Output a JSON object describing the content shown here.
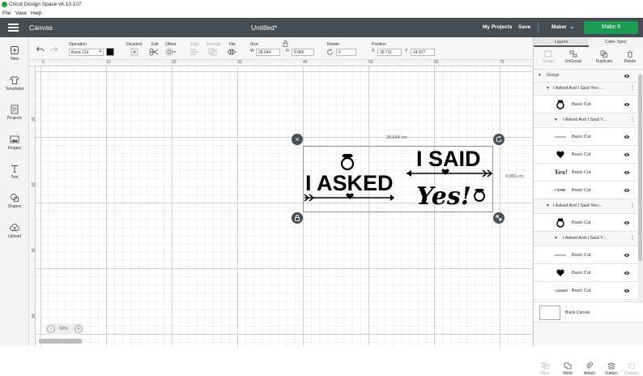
{
  "app": {
    "title": "Cricut Design Space  v6.10.107",
    "menu": [
      "File",
      "View",
      "Help"
    ]
  },
  "header": {
    "canvas_label": "Canvas",
    "doc_title": "Untitled*",
    "my_projects": "My Projects",
    "save": "Save",
    "machine": "Maker",
    "make_it": "Make It"
  },
  "sidebar": {
    "items": [
      {
        "label": "New",
        "icon": "plus-icon"
      },
      {
        "label": "Templates",
        "icon": "shirt-icon"
      },
      {
        "label": "Projects",
        "icon": "projects-icon"
      },
      {
        "label": "Images",
        "icon": "image-icon"
      },
      {
        "label": "Text",
        "icon": "text-icon"
      },
      {
        "label": "Shapes",
        "icon": "shapes-icon"
      },
      {
        "label": "Upload",
        "icon": "upload-icon"
      }
    ]
  },
  "toolbar": {
    "operation_label": "Operation",
    "operation_value": "Basic Cut",
    "deselect": "Deselect",
    "edit": "Edit",
    "offset": "Offset",
    "align": "Align",
    "arrange": "Arrange",
    "flip": "Flip",
    "size": "Size",
    "w_label": "W",
    "w_value": "28.644",
    "h_label": "H",
    "h_value": "9.966",
    "rotate": "Rotate",
    "rotate_value": "0",
    "position": "Position",
    "x_label": "X",
    "x_value": "39.711",
    "y_label": "Y",
    "y_value": "14.977",
    "color": "#000000"
  },
  "canvas": {
    "ruler_top": [
      "0",
      "10",
      "20",
      "30",
      "40",
      "50",
      "60",
      "70"
    ],
    "ruler_left": [
      "10",
      "20",
      "30",
      "40"
    ],
    "width_label": "28.644 cm",
    "height_label": "9.966 cm",
    "zoom": "50%",
    "design": {
      "left_text": "I ASKED",
      "right_text_top": "I SAID",
      "right_text_script": "Yes!"
    }
  },
  "panel": {
    "tabs": [
      "Layers",
      "Color Sync"
    ],
    "actions_top": [
      "Group",
      "UnGroup",
      "Duplicate",
      "Delete"
    ],
    "layers": [
      {
        "label": "Group",
        "level": 0,
        "kind": "group"
      },
      {
        "label": "I Asked And I Said Yes-...",
        "level": 1,
        "kind": "group"
      },
      {
        "label": "Basic Cut",
        "level": 2,
        "kind": "ring"
      },
      {
        "label": "I Asked And I Said Y...",
        "level": 2,
        "kind": "group"
      },
      {
        "label": "Basic Cut",
        "level": 3,
        "kind": "line"
      },
      {
        "label": "Basic Cut",
        "level": 3,
        "kind": "heart"
      },
      {
        "label": "Basic Cut",
        "level": 3,
        "kind": "yes-text",
        "thumb_text": "Yes!"
      },
      {
        "label": "Basic Cut",
        "level": 3,
        "kind": "said-text",
        "thumb_text": "I SAID"
      },
      {
        "label": "I Asked And I Said Yes-...",
        "level": 1,
        "kind": "group"
      },
      {
        "label": "Basic Cut",
        "level": 2,
        "kind": "ring"
      },
      {
        "label": "I Asked And I Said Y...",
        "level": 2,
        "kind": "group"
      },
      {
        "label": "Basic Cut",
        "level": 3,
        "kind": "line"
      },
      {
        "label": "Basic Cut",
        "level": 3,
        "kind": "heart"
      },
      {
        "label": "Basic Cut",
        "level": 3,
        "kind": "asked-text",
        "thumb_text": "I ASKED"
      }
    ],
    "blank_canvas": "Blank Canvas",
    "actions_bottom": [
      "Slice",
      "Weld",
      "Attach",
      "Flatten",
      "Contour"
    ]
  }
}
